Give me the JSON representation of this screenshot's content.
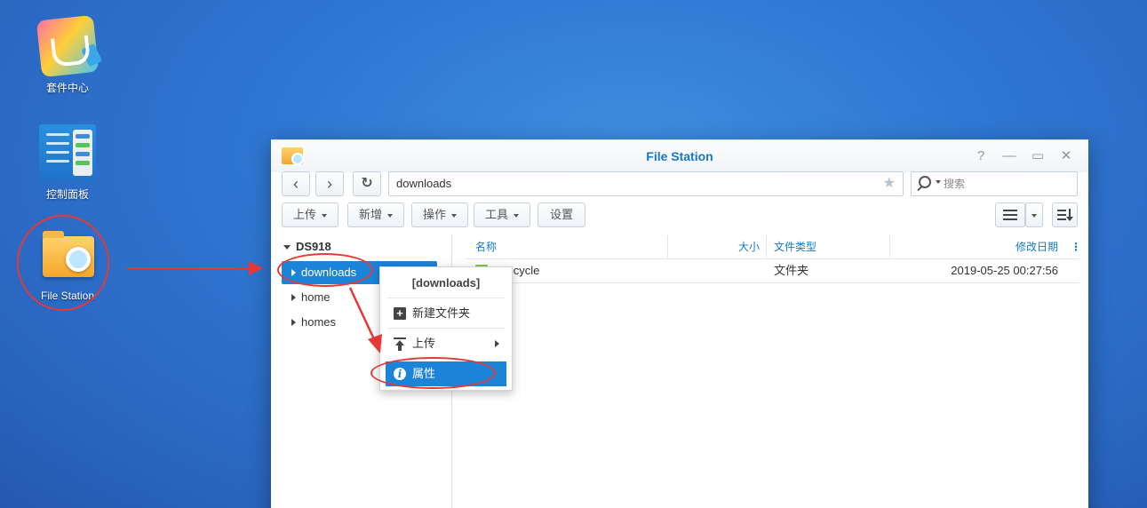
{
  "desktop": {
    "icons": [
      {
        "label": "套件中心",
        "icon": "package-center-icon"
      },
      {
        "label": "控制面板",
        "icon": "control-panel-icon"
      },
      {
        "label": "File Station",
        "icon": "file-station-icon"
      }
    ]
  },
  "window": {
    "title": "File Station",
    "controls": {
      "help": "?",
      "minimize": "—",
      "maximize": "▭",
      "close": "✕"
    },
    "nav": {
      "back": "‹",
      "forward": "›",
      "refresh": "↻",
      "path": "downloads",
      "favorite": "★",
      "search_placeholder": "搜索"
    },
    "toolbar": {
      "upload": "上传",
      "create": "新增",
      "action": "操作",
      "tools": "工具",
      "settings": "设置"
    },
    "tree": {
      "root": "DS918",
      "items": [
        {
          "label": "downloads",
          "selected": true
        },
        {
          "label": "home",
          "selected": false
        },
        {
          "label": "homes",
          "selected": false
        }
      ]
    },
    "list": {
      "columns": {
        "name": "名称",
        "size": "大小",
        "type": "文件类型",
        "modified": "修改日期"
      },
      "rows": [
        {
          "name": "#recycle",
          "size": "",
          "type": "文件夹",
          "modified": "2019-05-25 00:27:56"
        }
      ]
    }
  },
  "context_menu": {
    "title": "[downloads]",
    "items": [
      {
        "label": "新建文件夹",
        "icon": "new-folder-icon"
      },
      {
        "label": "上传",
        "icon": "upload-icon",
        "submenu": true
      },
      {
        "label": "属性",
        "icon": "info-icon",
        "selected": true
      }
    ]
  },
  "colors": {
    "accent": "#1b83d8",
    "title": "#1579c8",
    "annotation": "#e53935",
    "desktop": "#2f77d2"
  }
}
